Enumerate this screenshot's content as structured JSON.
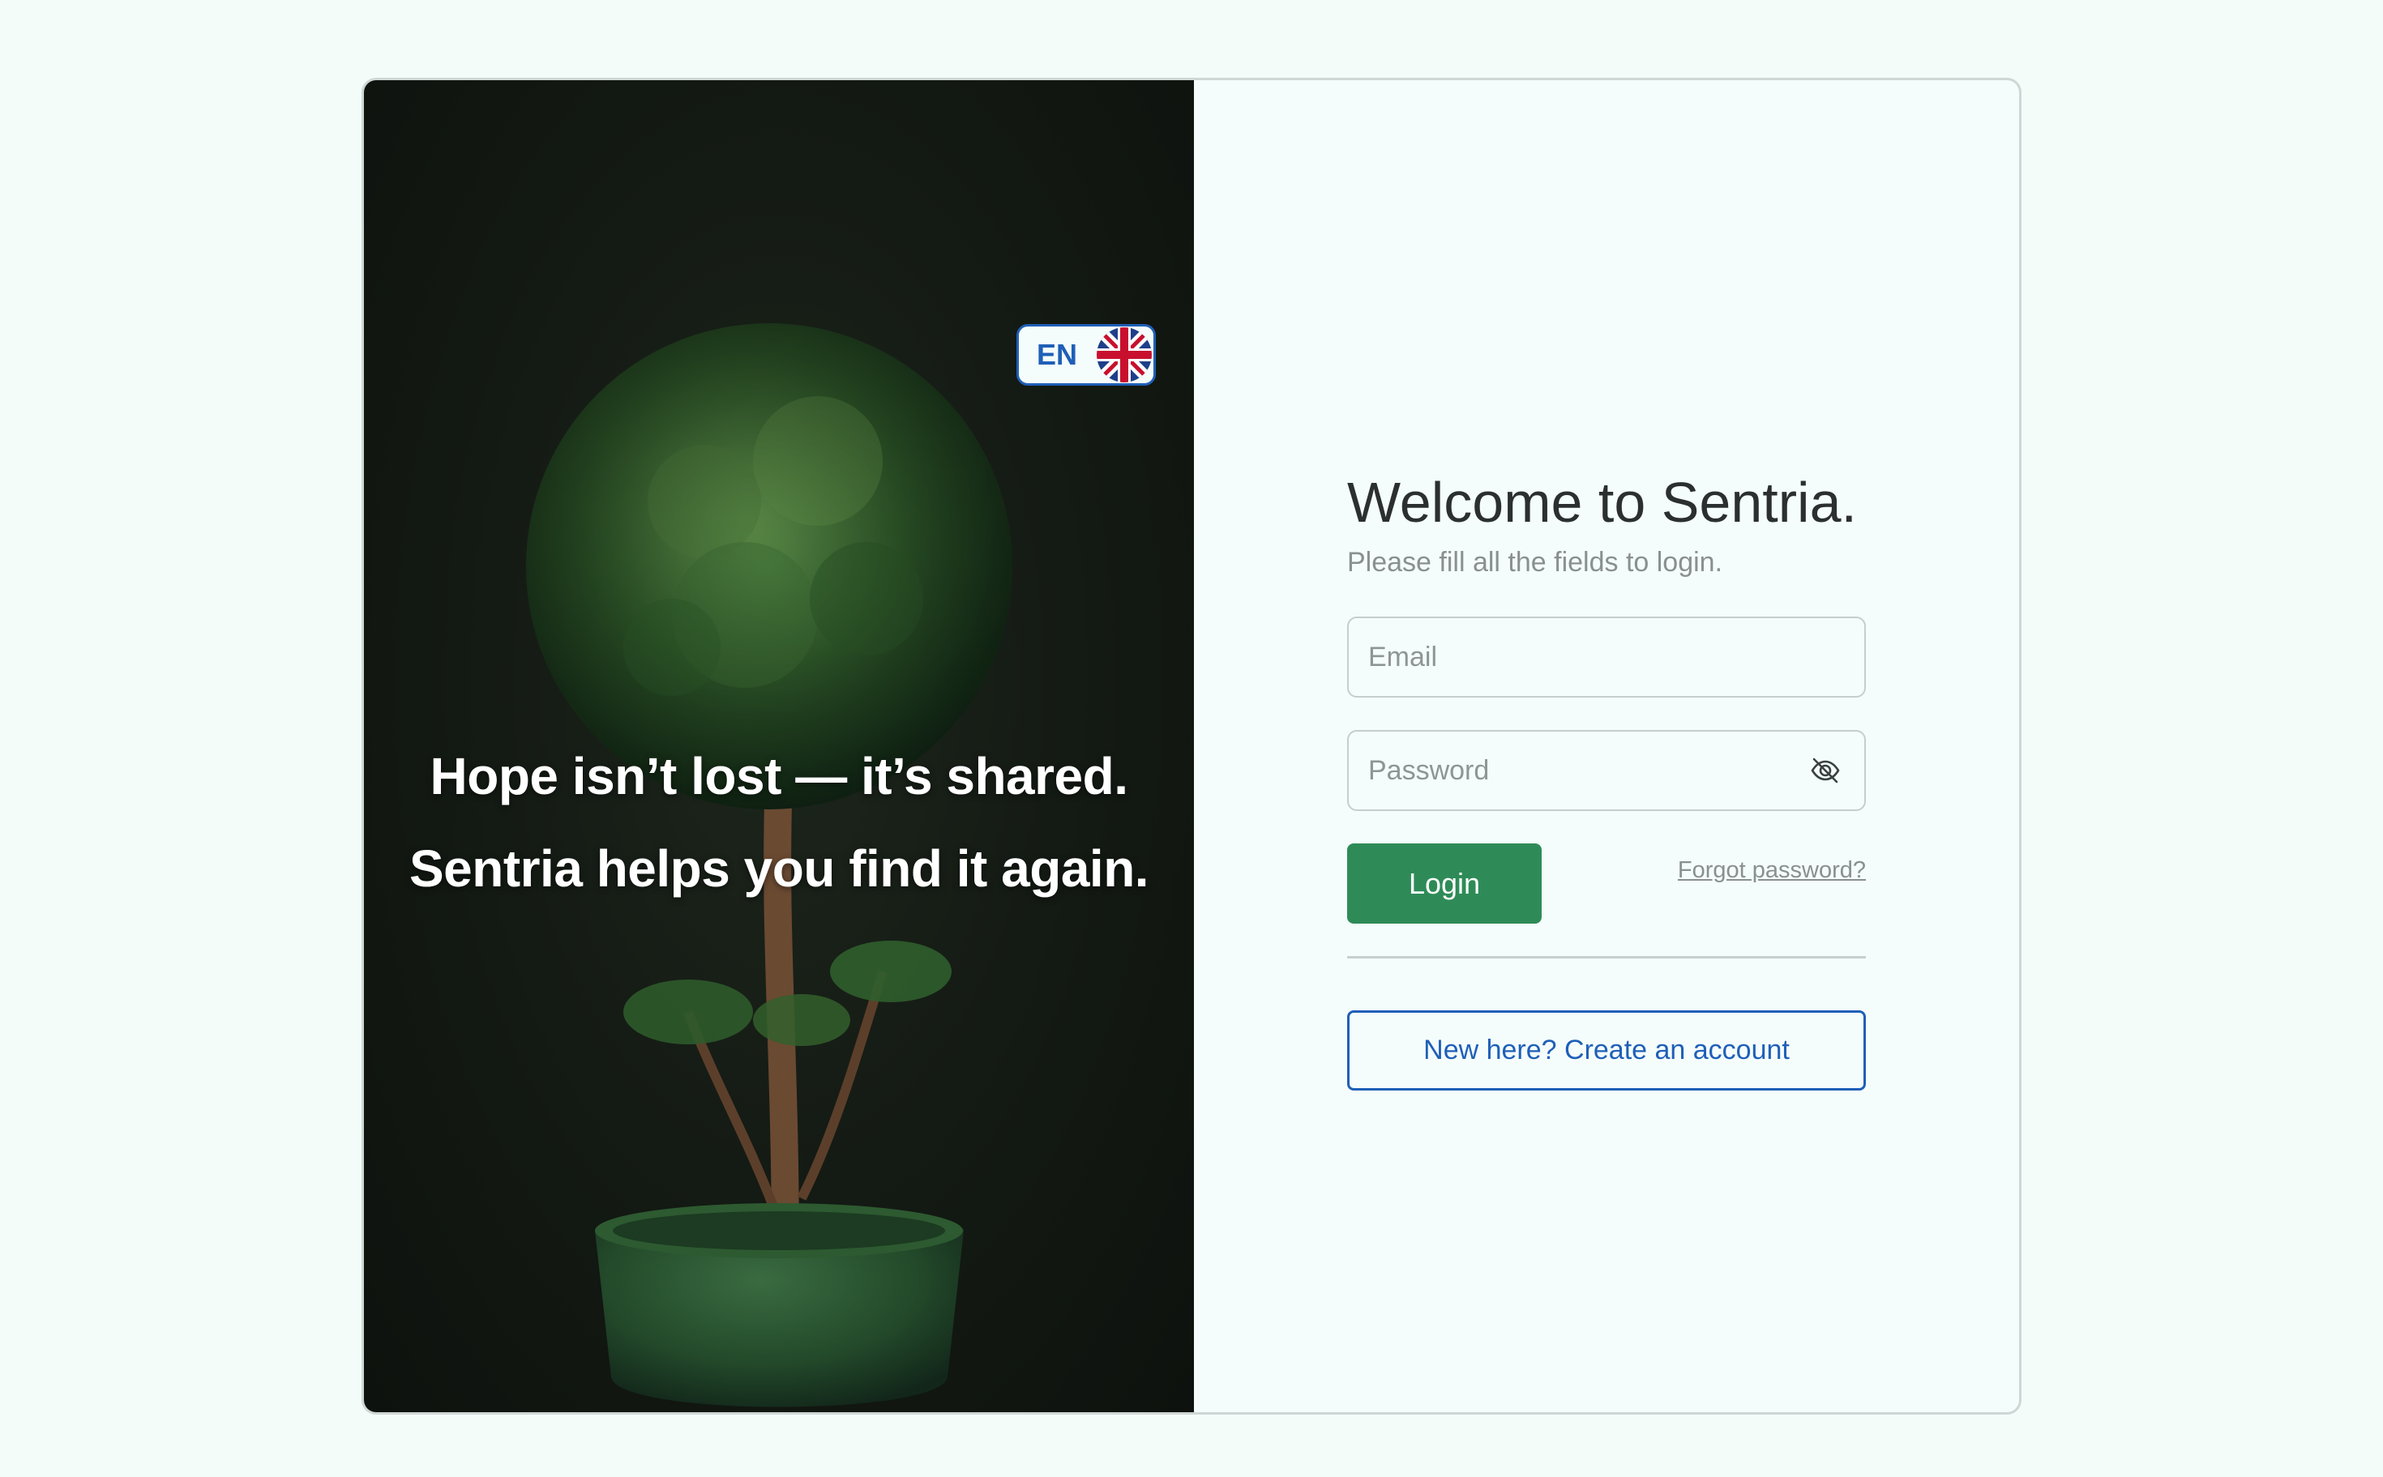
{
  "hero": {
    "line1": "Hope isn’t lost — it’s shared.",
    "line2": "Sentria helps you find it again.",
    "carousel": {
      "slides": 3,
      "active_index": 1
    }
  },
  "language": {
    "label": "EN",
    "flag_icon": "uk-flag-icon"
  },
  "login": {
    "title": "Welcome to Sentria.",
    "subtitle": "Please fill all the fields to login.",
    "email_placeholder": "Email",
    "email_value": "",
    "password_placeholder": "Password",
    "password_value": "",
    "password_toggle_icon": "eye-slash-icon",
    "login_label": "Login",
    "forgot_label": "Forgot password?",
    "create_account_label": "New here? Create an account"
  },
  "colors": {
    "primary_green": "#2e8b57",
    "accent_blue": "#1f5fb8",
    "background": "#f4fcfa"
  }
}
